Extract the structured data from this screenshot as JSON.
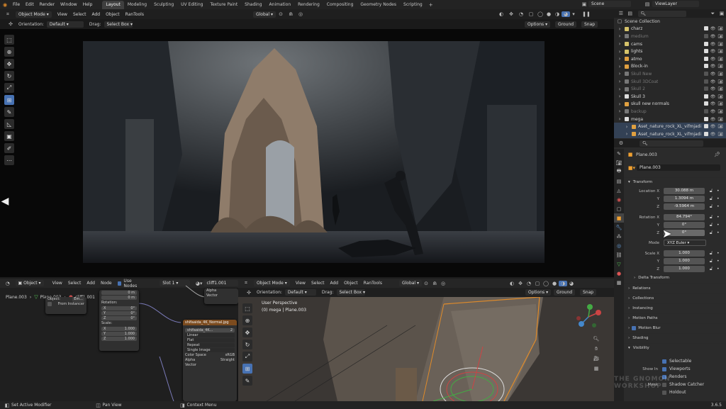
{
  "topbar": {
    "menus": [
      "File",
      "Edit",
      "Render",
      "Window",
      "Help"
    ],
    "workspaces": [
      "Layout",
      "Modeling",
      "Sculpting",
      "UV Editing",
      "Texture Paint",
      "Shading",
      "Animation",
      "Rendering",
      "Compositing",
      "Geometry Nodes",
      "Scripting"
    ],
    "scene": "Scene",
    "view_layer": "ViewLayer"
  },
  "viewport_top": {
    "mode": "Object Mode",
    "menus": [
      "View",
      "Select",
      "Add",
      "Object",
      "RanTools"
    ],
    "orientation_space": "Global",
    "orientation_label": "Orientation:",
    "orientation_value": "Default",
    "drag_label": "Drag:",
    "drag_value": "Select Box",
    "options": "Options",
    "ground": "Ground",
    "snap": "Snap"
  },
  "outliner": {
    "title": "Scene Collection",
    "items": [
      {
        "label": "charz",
        "state": "on",
        "dot": "#d6c36a"
      },
      {
        "label": "medium",
        "state": "off",
        "dot": "#777"
      },
      {
        "label": "cams",
        "state": "on",
        "dot": "#d6c36a"
      },
      {
        "label": "lights",
        "state": "on",
        "dot": "#d6c36a"
      },
      {
        "label": "atmo",
        "state": "on",
        "dot": "#e0a040"
      },
      {
        "label": "Block-in",
        "state": "on",
        "dot": "#e0a040"
      },
      {
        "label": "Skull New",
        "state": "off",
        "dot": "#777"
      },
      {
        "label": "Skull 3DCoat",
        "state": "off",
        "dot": "#777"
      },
      {
        "label": "Skull 2",
        "state": "off",
        "dot": "#777"
      },
      {
        "label": "Skull 3",
        "state": "on",
        "dot": "#ddd"
      },
      {
        "label": "skull new normals",
        "state": "on",
        "dot": "#e0a040"
      },
      {
        "label": "backup",
        "state": "off",
        "dot": "#777"
      },
      {
        "label": "mega",
        "state": "on",
        "dot": "#ddd"
      },
      {
        "label": "Aset_nature_rock_XL_vifmjadi",
        "state": "on",
        "dot": "#e0a040"
      },
      {
        "label": "Aset_nature_rock_XL_vifmjadi",
        "state": "on",
        "dot": "#e0a040"
      }
    ]
  },
  "properties": {
    "object_name": "Plane.003",
    "data_name": "Plane.003",
    "transform_title": "Transform",
    "location": {
      "label": "Location X",
      "x": "30.088 m",
      "y": "1.3094 m",
      "z": "-9.5964 m"
    },
    "rotation": {
      "label": "Rotation X",
      "x": "84.794°",
      "y": "0°",
      "z": "0°"
    },
    "axis_y": "Y",
    "axis_z": "Z",
    "mode_label": "Mode",
    "mode_value": "XYZ Euler",
    "scale": {
      "label": "Scale X",
      "x": "1.000",
      "y": "1.000",
      "z": "1.000"
    },
    "panels": [
      "Delta Transform",
      "Relations",
      "Collections",
      "Instancing",
      "Motion Paths",
      "Motion Blur",
      "Shading",
      "Visibility"
    ],
    "visibility": {
      "selectable": "Selectable",
      "show_in": "Show In",
      "viewports": "Viewports",
      "renders": "Renders",
      "mask": "Mask",
      "shadow_catcher": "Shadow Catcher",
      "holdout": "Holdout"
    }
  },
  "node_editor": {
    "type": "Object",
    "menus": [
      "View",
      "Select",
      "Add",
      "Node"
    ],
    "use_nodes": "Use Nodes",
    "slot": "Slot 1",
    "material": "cliff1.001",
    "object_name": "Plane.003",
    "material_short": "cliff1.001",
    "from_instancer": "From Instancer",
    "object_label": "Object:",
    "object_value": "Em...",
    "rotation_label": "Rotation:",
    "scale_label": "Scale:",
    "rot": [
      "0°",
      "0°",
      "0°"
    ],
    "scale": [
      "1.000",
      "1.000",
      "1.000"
    ],
    "loc": [
      "0 m",
      "0 m"
    ],
    "alpha": "Alpha",
    "vector": "Vector",
    "image_node": {
      "title": "shifaaida_4K_Normal.jpg",
      "file": "shifaaida_4K...",
      "users": "2",
      "options": [
        "Linear",
        "Flat",
        "Repeat",
        "Single Image"
      ],
      "color_space_label": "Color Space",
      "color_space": "sRGB",
      "alpha_label": "Alpha",
      "alpha": "Straight",
      "vector": "Vector"
    }
  },
  "viewport_bottom": {
    "mode": "Object Mode",
    "menus": [
      "View",
      "Select",
      "Add",
      "Object",
      "RanTools"
    ],
    "space": "Global",
    "orientation_label": "Orientation:",
    "orientation_value": "Default",
    "drag_label": "Drag:",
    "drag_value": "Select Box",
    "options": "Options",
    "ground": "Ground",
    "snap": "Snap",
    "overlay_title": "User Perspective",
    "overlay_sub": "(0) mega | Plane.003"
  },
  "statusbar": {
    "left": "Set Active Modifier",
    "middle": "Pan View",
    "right": "Context Menu",
    "version": "3.6.5"
  },
  "watermark": "THE GNOMON WORKSHOP",
  "colors": {
    "accent": "#4772b3",
    "orange": "#e08b2a"
  }
}
